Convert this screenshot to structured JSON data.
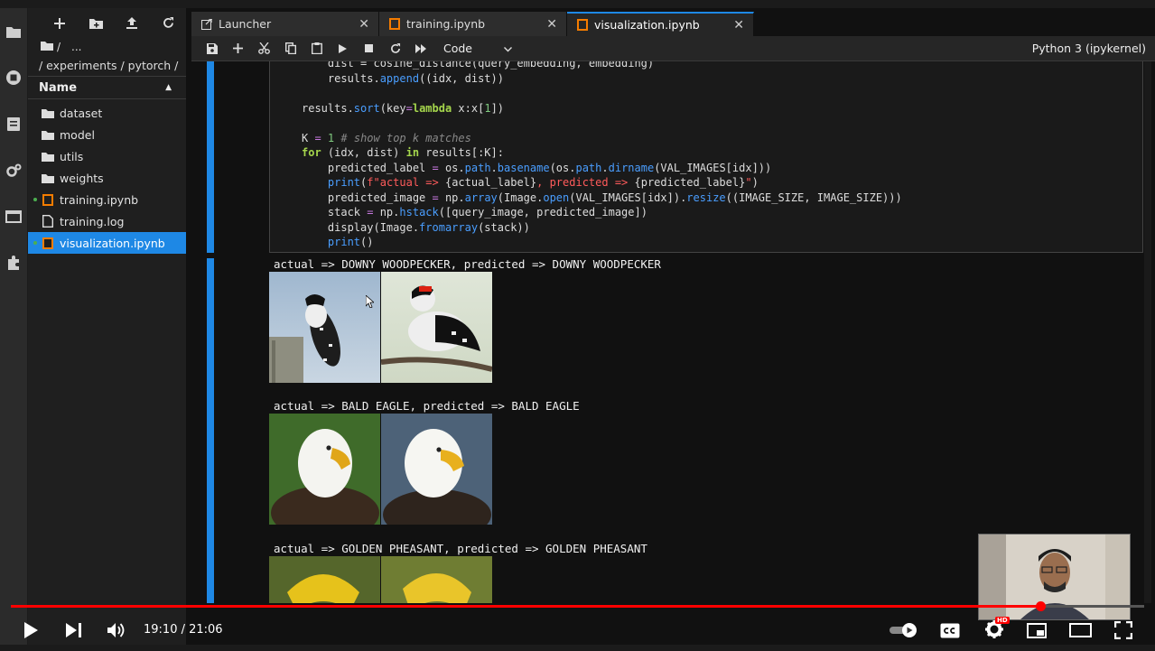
{
  "filebrowser": {
    "crumb_root": "/",
    "crumb_more": "...",
    "path": "/ experiments / pytorch /",
    "header_name": "Name",
    "items": [
      {
        "label": "dataset",
        "kind": "folder"
      },
      {
        "label": "model",
        "kind": "folder"
      },
      {
        "label": "utils",
        "kind": "folder"
      },
      {
        "label": "weights",
        "kind": "folder"
      },
      {
        "label": "training.ipynb",
        "kind": "notebook"
      },
      {
        "label": "training.log",
        "kind": "file"
      },
      {
        "label": "visualization.ipynb",
        "kind": "notebook"
      }
    ]
  },
  "tabs": [
    {
      "label": "Launcher"
    },
    {
      "label": "training.ipynb"
    },
    {
      "label": "visualization.ipynb"
    }
  ],
  "toolbar": {
    "cell_type": "Code",
    "kernel": "Python 3 (ipykernel)"
  },
  "outputs": [
    {
      "text": "actual => DOWNY WOODPECKER, predicted => DOWNY WOODPECKER"
    },
    {
      "text": "actual => BALD EAGLE, predicted => BALD EAGLE"
    },
    {
      "text": "actual => GOLDEN PHEASANT, predicted => GOLDEN PHEASANT"
    }
  ],
  "player": {
    "time": "19:10 / 21:06",
    "progress": 0.908,
    "hd_badge": "HD",
    "accent": "#ff0000"
  },
  "colors": {
    "selection": "#1e88e5",
    "background": "#111111"
  }
}
